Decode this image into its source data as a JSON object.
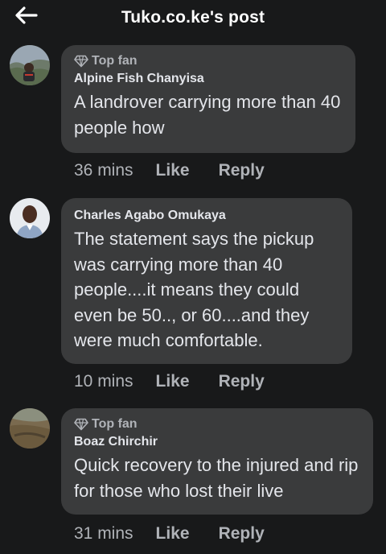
{
  "header": {
    "title": "Tuko.co.ke's post"
  },
  "comments": [
    {
      "badge": "Top fan",
      "author": "Alpine Fish Chanyisa",
      "text": "A landrover carrying more than 40 people how",
      "time": "36 mins",
      "like_label": "Like",
      "reply_label": "Reply"
    },
    {
      "badge": "",
      "author": "Charles Agabo Omukaya",
      "text": "The statement says the pickup was carrying more than 40 people....it means they could even be 50.., or 60....and they were much comfortable.",
      "time": "10 mins",
      "like_label": "Like",
      "reply_label": "Reply"
    },
    {
      "badge": "Top fan",
      "author": "Boaz Chirchir",
      "text": "Quick recovery to the injured and rip for those who lost their live",
      "time": "31 mins",
      "like_label": "Like",
      "reply_label": "Reply"
    }
  ],
  "colors": {
    "background": "#18191a",
    "bubble": "#3a3b3c",
    "primary_text": "#e4e6eb",
    "secondary_text": "#b0b3b8"
  },
  "icons": {
    "back": "arrow-left-icon",
    "badge": "diamond-icon"
  }
}
